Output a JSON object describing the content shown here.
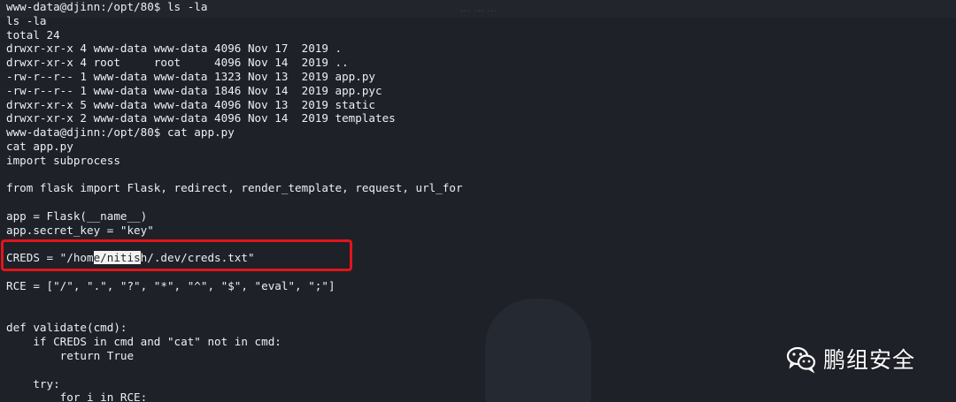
{
  "background_page": {
    "topbar_text": "... ... ...",
    "heading": "",
    "paragraph": "",
    "bullets": []
  },
  "terminal": {
    "lines": [
      "www-data@djinn:/opt/80$ ls -la",
      "ls -la",
      "total 24",
      "drwxr-xr-x 4 www-data www-data 4096 Nov 17  2019 .",
      "drwxr-xr-x 4 root     root     4096 Nov 14  2019 ..",
      "-rw-r--r-- 1 www-data www-data 1323 Nov 13  2019 app.py",
      "-rw-r--r-- 1 www-data www-data 1846 Nov 14  2019 app.pyc",
      "drwxr-xr-x 5 www-data www-data 4096 Nov 13  2019 static",
      "drwxr-xr-x 2 www-data www-data 4096 Nov 14  2019 templates",
      "www-data@djinn:/opt/80$ cat app.py",
      "cat app.py",
      "import subprocess",
      "",
      "from flask import Flask, redirect, render_template, request, url_for",
      "",
      "app = Flask(__name__)",
      "app.secret_key = \"key\"",
      "",
      "CREDS = \"/home/nitish/.dev/creds.txt\"",
      "",
      "RCE = [\"/\", \".\", \"?\", \"*\", \"^\", \"$\", \"eval\", \";\"]",
      "",
      "",
      "def validate(cmd):",
      "    if CREDS in cmd and \"cat\" not in cmd:",
      "        return True",
      "",
      "    try:",
      "        for i in RCE:"
    ],
    "selection": {
      "line_index": 18,
      "before": "CREDS = \"/hom",
      "selected": "e/nitis",
      "after": "h/.dev/creds.txt\""
    }
  },
  "watermark": {
    "icon": "wechat-icon",
    "text": "鹏组安全"
  }
}
